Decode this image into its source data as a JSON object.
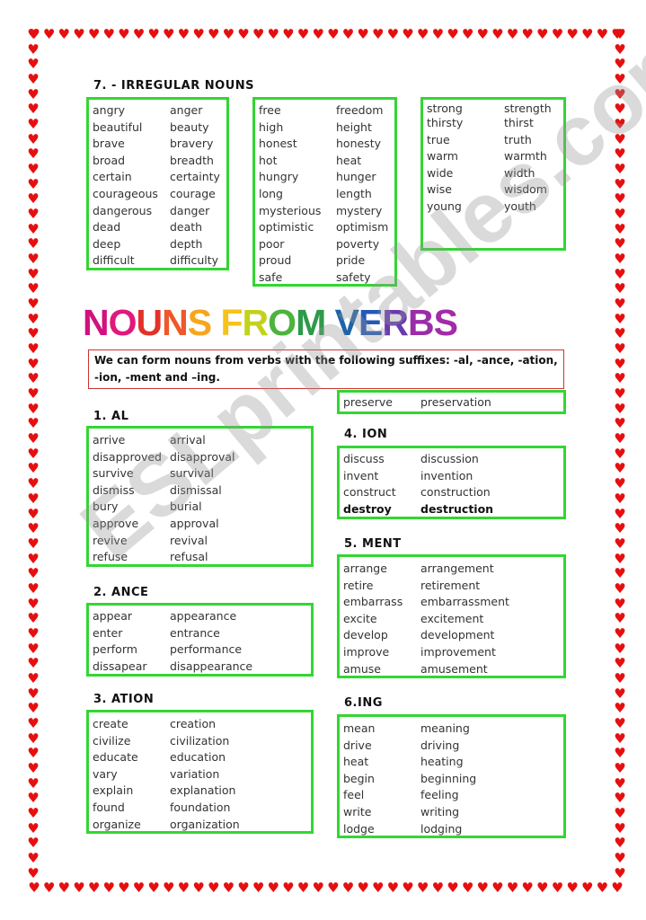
{
  "border": {
    "icon": "heart-icon",
    "color": "#e60f0f"
  },
  "irregular": {
    "title": "7. - IRREGULAR NOUNS",
    "col1": [
      [
        "angry",
        "anger"
      ],
      [
        "beautiful",
        "beauty"
      ],
      [
        "brave",
        "bravery"
      ],
      [
        "broad",
        "breadth"
      ],
      [
        "certain",
        "certainty"
      ],
      [
        "courageous",
        "courage"
      ],
      [
        "dangerous",
        "danger"
      ],
      [
        "dead",
        "death"
      ],
      [
        "deep",
        "depth"
      ],
      [
        "difficult",
        "difficulty"
      ]
    ],
    "col2": [
      [
        "free",
        "freedom"
      ],
      [
        "high",
        "height"
      ],
      [
        "honest",
        "honesty"
      ],
      [
        "hot",
        "heat"
      ],
      [
        "hungry",
        "hunger"
      ],
      [
        "long",
        "length"
      ],
      [
        "mysterious",
        "mystery"
      ],
      [
        "optimistic",
        "optimism"
      ],
      [
        "poor",
        "poverty"
      ],
      [
        "proud",
        "pride"
      ],
      [
        "safe",
        "safety"
      ]
    ],
    "col3": [
      [
        "strong",
        "strength"
      ],
      [
        "thirsty",
        "thirst"
      ],
      [
        "true",
        "truth"
      ],
      [
        "warm",
        "warmth"
      ],
      [
        "wide",
        "width"
      ],
      [
        "wise",
        "wisdom"
      ],
      [
        "young",
        "youth"
      ]
    ]
  },
  "heading": {
    "title": "NOUNS FROM VERBS",
    "colors": [
      "#d1117f",
      "#e0197d",
      "#e2322a",
      "#f0572a",
      "#f7a61c",
      "#f7c21a",
      "#c2d21c",
      "#4cb43d",
      "#2e9a4a",
      "#1c64a8",
      "#2658b6",
      "#6a3ab0",
      "#9b2da8",
      "#a32aa8"
    ]
  },
  "intro": "We can form nouns from verbs with the following suffixes: -al, -ance, -ation, -ion, -ment and –ing.",
  "sections": {
    "al": {
      "title": "1. AL",
      "rows": [
        [
          "arrive",
          "arrival"
        ],
        [
          "disapproved",
          "disapproval"
        ],
        [
          "survive",
          "survival"
        ],
        [
          "dismiss",
          "dismissal"
        ],
        [
          "bury",
          "burial"
        ],
        [
          "approve",
          "approval"
        ],
        [
          "revive",
          "revival"
        ],
        [
          "refuse",
          "refusal"
        ]
      ]
    },
    "ance": {
      "title": "2. ANCE",
      "rows": [
        [
          "appear",
          "appearance"
        ],
        [
          "enter",
          "entrance"
        ],
        [
          "perform",
          "performance"
        ],
        [
          "dissapear",
          "disappearance"
        ]
      ]
    },
    "ation": {
      "title": "3. ATION",
      "rows": [
        [
          "create",
          "creation"
        ],
        [
          "civilize",
          "civilization"
        ],
        [
          "educate",
          "education"
        ],
        [
          "vary",
          "variation"
        ],
        [
          "explain",
          "explanation"
        ],
        [
          "found",
          "foundation"
        ],
        [
          "organize",
          "organization"
        ]
      ]
    },
    "ation_extra": {
      "rows": [
        [
          "preserve",
          "preservation"
        ]
      ]
    },
    "ion": {
      "title": "4. ION",
      "rows": [
        [
          "discuss",
          "discussion"
        ],
        [
          "invent",
          "invention"
        ],
        [
          "construct",
          "construction"
        ],
        [
          "destroy",
          "destruction"
        ]
      ],
      "bold_row": 3
    },
    "ment": {
      "title": "5. MENT",
      "rows": [
        [
          "arrange",
          "arrangement"
        ],
        [
          "retire",
          "retirement"
        ],
        [
          "embarrass",
          "embarrassment"
        ],
        [
          "excite",
          "excitement"
        ],
        [
          "develop",
          "development"
        ],
        [
          "improve",
          "improvement"
        ],
        [
          "amuse",
          "amusement"
        ]
      ]
    },
    "ing": {
      "title": "6.ING",
      "rows": [
        [
          "mean",
          "meaning"
        ],
        [
          "drive",
          "driving"
        ],
        [
          "heat",
          "heating"
        ],
        [
          "begin",
          "beginning"
        ],
        [
          "feel",
          "feeling"
        ],
        [
          "write",
          "writing"
        ],
        [
          "lodge",
          "lodging"
        ]
      ]
    }
  },
  "watermark": "ESLprintables.com"
}
